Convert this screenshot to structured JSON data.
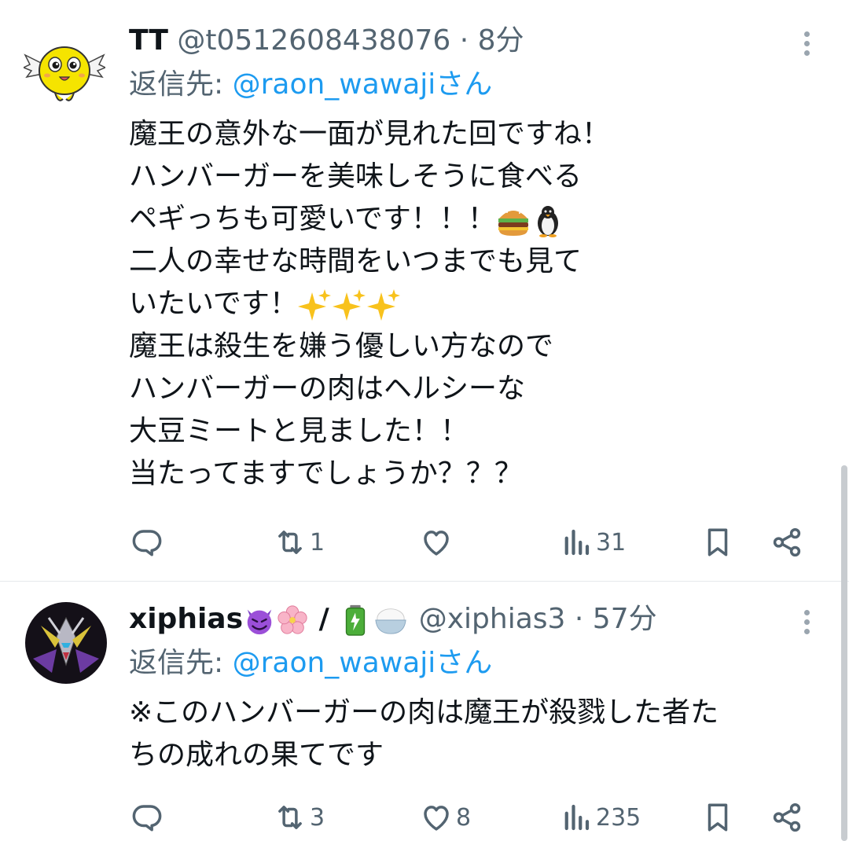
{
  "tweets": [
    {
      "name": "TT",
      "handle": "@t0512608438076",
      "time": "8分",
      "reply_prefix": "返信先: ",
      "reply_mention": "@raon_wawaji",
      "reply_suffix": "さん",
      "lines": [
        "魔王の意外な一面が見れた回ですね！",
        "ハンバーガーを美味しそうに食べる",
        "ペギっちも可愛いです！！！",
        "二人の幸せな時間をいつまでも見て",
        "いたいです！",
        "魔王は殺生を嫌う優しい方なので",
        "ハンバーガーの肉はヘルシーな",
        "大豆ミートと見ました！！",
        "当たってますでしょうか？？？"
      ],
      "line3_emojis": [
        "hamburger-emoji",
        "penguin-emoji"
      ],
      "line5_emojis": [
        "sparkles-emoji",
        "sparkles-emoji",
        "sparkles-emoji"
      ],
      "reply_count": "",
      "retweet_count": "1",
      "like_count": "",
      "views_count": "31"
    },
    {
      "name": "xiphias",
      "name_separator": "/",
      "name_emojis_before": [
        "smiling-devil-emoji",
        "cherry-blossom-emoji"
      ],
      "name_emojis_after": [
        "battery-emoji",
        "rice-bowl-emoji"
      ],
      "handle": "@xiphias3",
      "time": "57分",
      "reply_prefix": "返信先: ",
      "reply_mention": "@raon_wawaji",
      "reply_suffix": "さん",
      "lines": [
        "※このハンバーガーの肉は魔王が殺戮した者た",
        "ちの成れの果てです"
      ],
      "reply_count": "",
      "retweet_count": "3",
      "like_count": "8",
      "views_count": "235"
    }
  ],
  "colors": {
    "text": "#0f1419",
    "secondary": "#536471",
    "link": "#1d9bf0",
    "divider": "#e6e9ec"
  }
}
